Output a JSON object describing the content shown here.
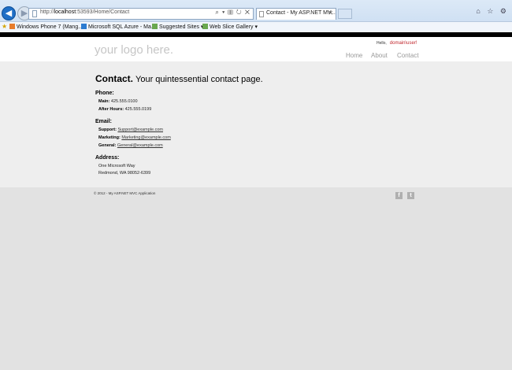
{
  "browser": {
    "address": {
      "prefix": "http://",
      "host": "localhost",
      "rest": ":53593/Home/Contact"
    },
    "address_actions": "⌕ ▾ ▥ ↻ ✕",
    "tab_title": "Contact - My ASP.NET MV...",
    "tab_close": "✕",
    "toolbar_icons": "⌂ ☆ ⚙",
    "favorites": [
      {
        "label": "Windows Phone 7 (Mang...",
        "color": "#e87d2c"
      },
      {
        "label": "Microsoft SQL Azure - Ma...",
        "color": "#2b7bd1"
      },
      {
        "label": "Suggested Sites ▾",
        "color": "#6aa84f"
      },
      {
        "label": "Web Slice Gallery ▾",
        "color": "#6aa84f"
      }
    ]
  },
  "header": {
    "logo": "your logo here.",
    "login_greeting": "Hello,",
    "login_user": "domain\\user!",
    "menu": [
      "Home",
      "About",
      "Contact"
    ]
  },
  "main": {
    "title": "Contact.",
    "subtitle": "Your quintessential contact page.",
    "phone": {
      "heading": "Phone:",
      "main_label": "Main:",
      "main_value": "425.555.0100",
      "after_label": "After Hours:",
      "after_value": "425.555.0199"
    },
    "email": {
      "heading": "Email:",
      "support_label": "Support:",
      "support_value": "Support@example.com",
      "marketing_label": "Marketing:",
      "marketing_value": "Marketing@example.com",
      "general_label": "General:",
      "general_value": "General@example.com"
    },
    "address": {
      "heading": "Address:",
      "line1": "One Microsoft Way",
      "line2": "Redmond, WA 98052-6399"
    }
  },
  "footer": {
    "copyright": "© 2012 - My ASP.NET MVC Application",
    "social": [
      "f",
      "t"
    ]
  }
}
